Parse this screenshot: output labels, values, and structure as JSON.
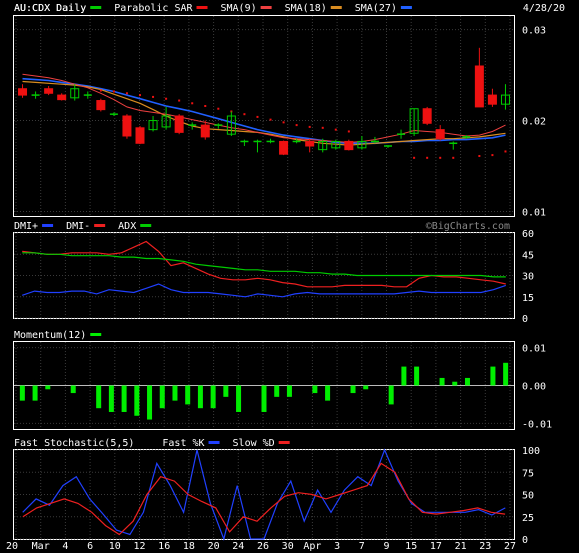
{
  "header": {
    "symbol_title": "AU:CDX Daily",
    "date": "4/28/20"
  },
  "colors": {
    "background": "#000000",
    "frame": "#ffffff",
    "grid": "#3a3a3a",
    "up_candle": "#00cc00",
    "down_candle": "#ee1111",
    "sar": "#ee1111",
    "sma9": "#ee4040",
    "sma18": "#d98c20",
    "sma27": "#2060ff",
    "dmi_plus": "#2040ff",
    "dmi_minus": "#ee2020",
    "adx": "#00cc00",
    "momentum": "#00ee00",
    "fast_k": "#2040ff",
    "slow_d": "#ee2020",
    "watermark": "#8a8a8a"
  },
  "watermark": "©BigCharts.com",
  "x_axis": {
    "labels": [
      "20",
      "Mar",
      "4",
      "6",
      "10",
      "12",
      "16",
      "18",
      "20",
      "24",
      "26",
      "30",
      "Apr",
      "3",
      "7",
      "9",
      "15",
      "17",
      "21",
      "23",
      "27"
    ]
  },
  "chart_data": [
    {
      "type": "candlestick",
      "name": "price",
      "legend": [
        {
          "label": "AU:CDX Daily",
          "color": "#00cc00"
        },
        {
          "label": "Parabolic SAR",
          "color": "#ee1111"
        },
        {
          "label": "SMA(9)",
          "color": "#ee4040"
        },
        {
          "label": "SMA(18)",
          "color": "#d98c20"
        },
        {
          "label": "SMA(27)",
          "color": "#2060ff"
        }
      ],
      "y_ticks": [
        "0.03",
        "0.02",
        "0.01"
      ],
      "y_tick_values": [
        0.03,
        0.02,
        0.01
      ],
      "ylim": [
        0.0095,
        0.0315
      ],
      "candles": [
        {
          "o": 0.0235,
          "h": 0.024,
          "l": 0.0225,
          "c": 0.0228
        },
        {
          "o": 0.0228,
          "h": 0.0232,
          "l": 0.0224,
          "c": 0.0228
        },
        {
          "o": 0.0235,
          "h": 0.0238,
          "l": 0.0228,
          "c": 0.023
        },
        {
          "o": 0.0228,
          "h": 0.023,
          "l": 0.0222,
          "c": 0.0223
        },
        {
          "o": 0.0225,
          "h": 0.024,
          "l": 0.0222,
          "c": 0.0235
        },
        {
          "o": 0.0228,
          "h": 0.0232,
          "l": 0.0224,
          "c": 0.0228
        },
        {
          "o": 0.0222,
          "h": 0.0224,
          "l": 0.021,
          "c": 0.0212
        },
        {
          "o": 0.0207,
          "h": 0.0209,
          "l": 0.0205,
          "c": 0.0207
        },
        {
          "o": 0.0205,
          "h": 0.0207,
          "l": 0.018,
          "c": 0.0183
        },
        {
          "o": 0.0192,
          "h": 0.0194,
          "l": 0.0174,
          "c": 0.0175
        },
        {
          "o": 0.019,
          "h": 0.0205,
          "l": 0.0188,
          "c": 0.02
        },
        {
          "o": 0.0193,
          "h": 0.0215,
          "l": 0.019,
          "c": 0.0205
        },
        {
          "o": 0.0205,
          "h": 0.0207,
          "l": 0.0185,
          "c": 0.0187
        },
        {
          "o": 0.0195,
          "h": 0.0198,
          "l": 0.019,
          "c": 0.0195
        },
        {
          "o": 0.0195,
          "h": 0.02,
          "l": 0.0179,
          "c": 0.0182
        },
        {
          "o": 0.0195,
          "h": 0.0197,
          "l": 0.0191,
          "c": 0.0195
        },
        {
          "o": 0.0185,
          "h": 0.021,
          "l": 0.0183,
          "c": 0.0205
        },
        {
          "o": 0.0177,
          "h": 0.0179,
          "l": 0.0172,
          "c": 0.0177
        },
        {
          "o": 0.0177,
          "h": 0.0179,
          "l": 0.0165,
          "c": 0.0177
        },
        {
          "o": 0.0177,
          "h": 0.018,
          "l": 0.0175,
          "c": 0.0177
        },
        {
          "o": 0.0177,
          "h": 0.0178,
          "l": 0.0162,
          "c": 0.0163
        },
        {
          "o": 0.0177,
          "h": 0.018,
          "l": 0.0175,
          "c": 0.0177
        },
        {
          "o": 0.0177,
          "h": 0.018,
          "l": 0.0165,
          "c": 0.0172
        },
        {
          "o": 0.0168,
          "h": 0.018,
          "l": 0.0165,
          "c": 0.0177
        },
        {
          "o": 0.017,
          "h": 0.0179,
          "l": 0.0168,
          "c": 0.0177
        },
        {
          "o": 0.0177,
          "h": 0.0179,
          "l": 0.0167,
          "c": 0.0168
        },
        {
          "o": 0.017,
          "h": 0.0183,
          "l": 0.0168,
          "c": 0.0177
        },
        {
          "o": 0.0177,
          "h": 0.0182,
          "l": 0.0175,
          "c": 0.0177
        },
        {
          "o": 0.0172,
          "h": 0.0173,
          "l": 0.017,
          "c": 0.0172
        },
        {
          "o": 0.0185,
          "h": 0.019,
          "l": 0.018,
          "c": 0.0185
        },
        {
          "o": 0.0186,
          "h": 0.0213,
          "l": 0.0183,
          "c": 0.0213
        },
        {
          "o": 0.0213,
          "h": 0.0215,
          "l": 0.0195,
          "c": 0.0197
        },
        {
          "o": 0.019,
          "h": 0.0195,
          "l": 0.0178,
          "c": 0.018
        },
        {
          "o": 0.0175,
          "h": 0.0177,
          "l": 0.0168,
          "c": 0.0175
        },
        {
          "o": 0.0182,
          "h": 0.0184,
          "l": 0.018,
          "c": 0.0182
        },
        {
          "o": 0.026,
          "h": 0.028,
          "l": 0.0215,
          "c": 0.0215
        },
        {
          "o": 0.0228,
          "h": 0.0235,
          "l": 0.0215,
          "c": 0.0218
        },
        {
          "o": 0.0218,
          "h": 0.024,
          "l": 0.0212,
          "c": 0.0228
        }
      ],
      "sma9": [
        0.0251,
        0.0249,
        0.0247,
        0.0244,
        0.024,
        0.0236,
        0.023,
        0.0223,
        0.0215,
        0.0211,
        0.0209,
        0.0207,
        0.0204,
        0.0201,
        0.0198,
        0.0195,
        0.0192,
        0.019,
        0.0187,
        0.0184,
        0.0181,
        0.018,
        0.0179,
        0.0178,
        0.0177,
        0.0176,
        0.0177,
        0.0179,
        0.0182,
        0.0185,
        0.0189,
        0.0188,
        0.0187,
        0.0185,
        0.0183,
        0.0184,
        0.0188,
        0.0195
      ],
      "sma18": [
        0.0243,
        0.0242,
        0.0241,
        0.024,
        0.0239,
        0.0237,
        0.0234,
        0.0229,
        0.0224,
        0.0219,
        0.0212,
        0.0205,
        0.0199,
        0.0194,
        0.0191,
        0.019,
        0.0189,
        0.0188,
        0.0187,
        0.0185,
        0.0182,
        0.0179,
        0.0177,
        0.0175,
        0.0174,
        0.0173,
        0.0174,
        0.0175,
        0.0176,
        0.0177,
        0.0178,
        0.0179,
        0.018,
        0.018,
        0.0181,
        0.0182,
        0.0184,
        0.0186
      ],
      "sma27": [
        0.0246,
        0.0245,
        0.0244,
        0.0242,
        0.024,
        0.0238,
        0.0235,
        0.0232,
        0.0228,
        0.0224,
        0.022,
        0.0216,
        0.0213,
        0.021,
        0.0206,
        0.0202,
        0.0198,
        0.0194,
        0.019,
        0.0187,
        0.0184,
        0.0182,
        0.018,
        0.0178,
        0.0176,
        0.0175,
        0.0175,
        0.0175,
        0.0176,
        0.0177,
        0.0177,
        0.0178,
        0.0178,
        0.0179,
        0.0179,
        0.018,
        0.0181,
        0.0184
      ],
      "sar": [
        null,
        null,
        null,
        null,
        null,
        null,
        0.0233,
        0.0232,
        0.023,
        0.0228,
        0.0226,
        0.0224,
        0.0222,
        0.0219,
        0.0216,
        0.0213,
        0.021,
        0.0207,
        0.0204,
        0.0201,
        0.0198,
        0.0195,
        0.0193,
        0.0192,
        0.019,
        0.0188,
        null,
        null,
        null,
        null,
        0.0159,
        0.0159,
        0.0159,
        0.0159,
        null,
        0.0161,
        0.0162,
        0.0166
      ]
    },
    {
      "type": "line",
      "name": "dmi",
      "legend": [
        {
          "label": "DMI+",
          "color": "#2040ff"
        },
        {
          "label": "DMI-",
          "color": "#ee2020"
        },
        {
          "label": "ADX",
          "color": "#00cc00"
        }
      ],
      "y_ticks": [
        "60",
        "45",
        "30",
        "15",
        "0"
      ],
      "y_tick_values": [
        60,
        45,
        30,
        15,
        0
      ],
      "ylim": [
        0,
        60
      ],
      "series": [
        {
          "name": "DMI+",
          "values": [
            16,
            19,
            18,
            18,
            19,
            19,
            17,
            20,
            19,
            18,
            21,
            24,
            20,
            18,
            18,
            18,
            17,
            16,
            15,
            17,
            16,
            15,
            17,
            18,
            17,
            17,
            17,
            17,
            17,
            17,
            17,
            18,
            19,
            18,
            18,
            18,
            18,
            18,
            20,
            23
          ]
        },
        {
          "name": "DMI-",
          "values": [
            47,
            46,
            45,
            45,
            46,
            46,
            46,
            45,
            46,
            50,
            54,
            47,
            37,
            39,
            35,
            31,
            28,
            27,
            27,
            28,
            27,
            25,
            24,
            22,
            22,
            22,
            23,
            23,
            23,
            23,
            22,
            22,
            28,
            30,
            29,
            29,
            28,
            27,
            26,
            24
          ]
        },
        {
          "name": "ADX",
          "values": [
            46,
            46,
            45,
            45,
            44,
            44,
            44,
            44,
            43,
            43,
            42,
            42,
            41,
            40,
            38,
            37,
            36,
            35,
            34,
            34,
            33,
            33,
            33,
            32,
            32,
            31,
            31,
            30,
            30,
            30,
            30,
            30,
            30,
            30,
            30,
            30,
            30,
            30,
            29,
            29
          ]
        }
      ]
    },
    {
      "type": "bar",
      "name": "momentum",
      "legend": [
        {
          "label": "Momentum(12)",
          "color": "#00ee00"
        }
      ],
      "y_ticks": [
        "0.01",
        "0.00",
        "-0.01"
      ],
      "y_tick_values": [
        0.01,
        0.0,
        -0.01
      ],
      "ylim": [
        -0.0115,
        0.0115
      ],
      "values": [
        -0.004,
        -0.004,
        -0.001,
        0.0,
        -0.002,
        0.0,
        -0.006,
        -0.007,
        -0.007,
        -0.008,
        -0.009,
        -0.006,
        -0.004,
        -0.005,
        -0.006,
        -0.006,
        -0.003,
        -0.007,
        0.0,
        -0.007,
        -0.003,
        -0.003,
        0.0,
        -0.002,
        -0.004,
        0.0,
        -0.002,
        -0.001,
        0.0,
        -0.005,
        0.005,
        0.005,
        0.0,
        0.002,
        0.001,
        0.002,
        0.0,
        0.005,
        0.006
      ]
    },
    {
      "type": "line",
      "name": "stochastic",
      "legend": [
        {
          "label": "Fast Stochastic(5,5)",
          "color": "#000000"
        },
        {
          "label": "Fast %K",
          "color": "#2040ff"
        },
        {
          "label": "Slow %D",
          "color": "#ee2020"
        }
      ],
      "y_ticks": [
        "100",
        "75",
        "50",
        "25",
        "0"
      ],
      "y_tick_values": [
        100,
        75,
        50,
        25,
        0
      ],
      "ylim": [
        0,
        100
      ],
      "series": [
        {
          "name": "Fast %K",
          "values": [
            30,
            45,
            38,
            60,
            70,
            45,
            28,
            10,
            5,
            30,
            85,
            60,
            30,
            100,
            40,
            0,
            60,
            0,
            0,
            40,
            65,
            20,
            55,
            30,
            55,
            70,
            60,
            100,
            65,
            40,
            30,
            30,
            30,
            30,
            33,
            27,
            35
          ]
        },
        {
          "name": "Slow %D",
          "values": [
            25,
            35,
            40,
            45,
            40,
            30,
            15,
            5,
            20,
            50,
            70,
            65,
            50,
            42,
            35,
            8,
            25,
            20,
            35,
            48,
            52,
            50,
            45,
            50,
            55,
            60,
            85,
            75,
            45,
            30,
            28,
            30,
            32,
            35,
            30,
            28
          ]
        }
      ]
    }
  ]
}
